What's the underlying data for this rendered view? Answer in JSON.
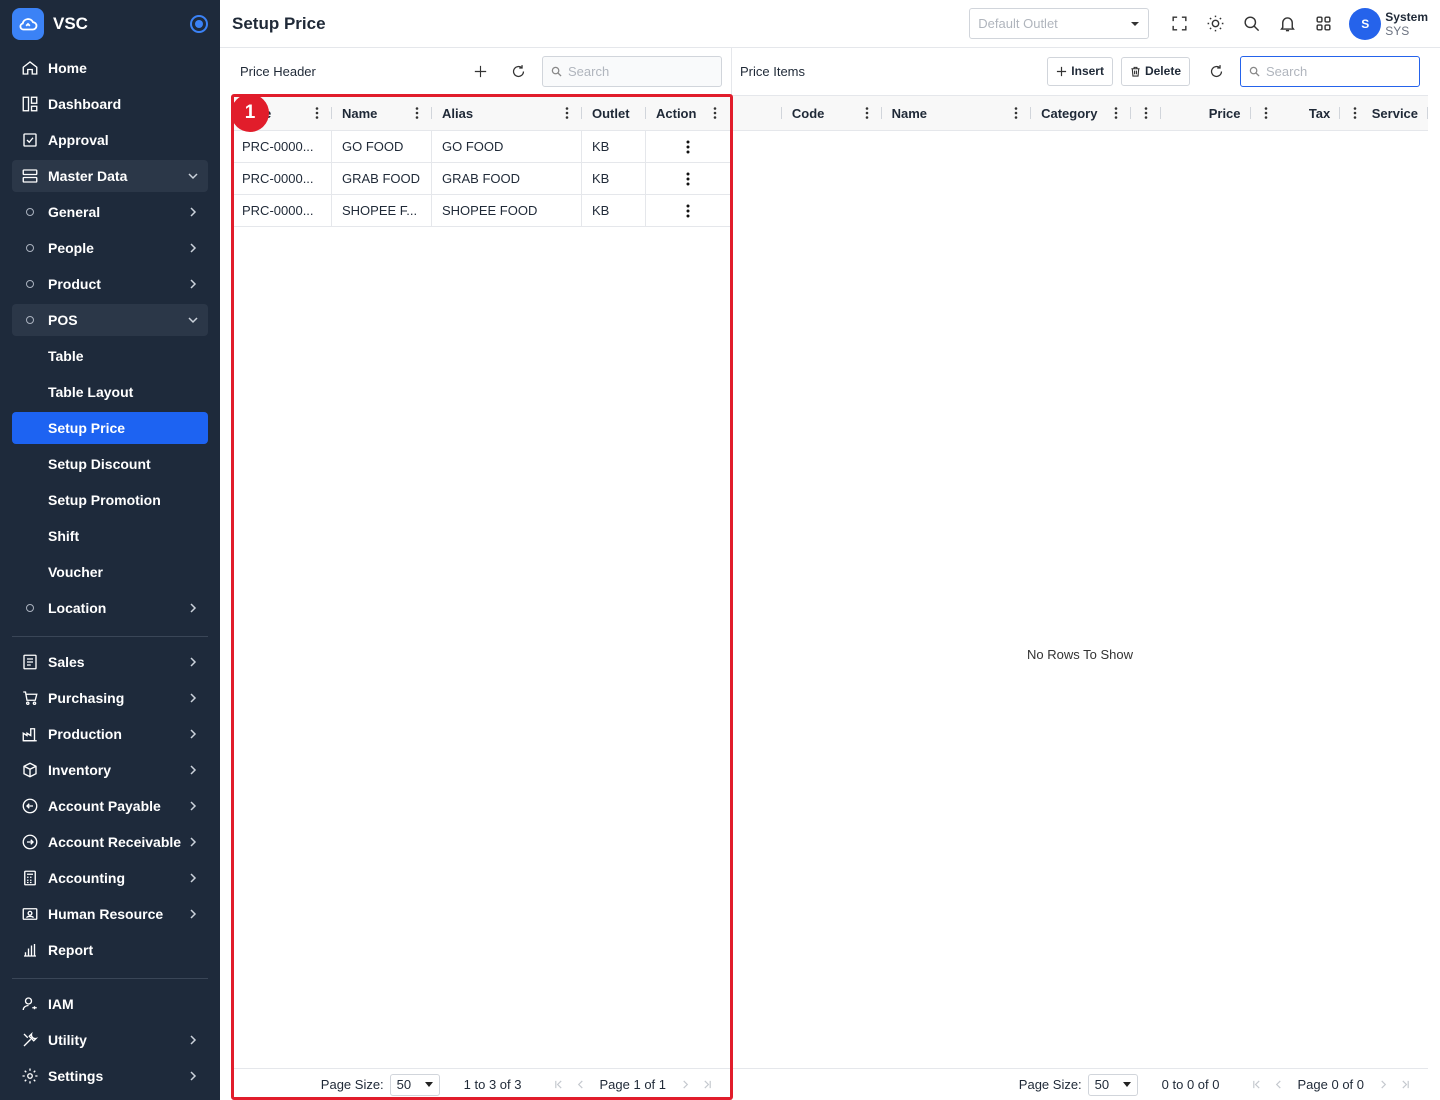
{
  "app": {
    "name": "VSC"
  },
  "sidebar": {
    "items": [
      {
        "label": "Home",
        "icon": "home-icon"
      },
      {
        "label": "Dashboard",
        "icon": "dashboard-icon"
      },
      {
        "label": "Approval",
        "icon": "approval-icon"
      },
      {
        "label": "Master Data",
        "icon": "master-data-icon"
      },
      {
        "label": "General"
      },
      {
        "label": "People"
      },
      {
        "label": "Product"
      },
      {
        "label": "POS"
      },
      {
        "label": "Table"
      },
      {
        "label": "Table Layout"
      },
      {
        "label": "Setup Price"
      },
      {
        "label": "Setup Discount"
      },
      {
        "label": "Setup Promotion"
      },
      {
        "label": "Shift"
      },
      {
        "label": "Voucher"
      },
      {
        "label": "Location"
      },
      {
        "label": "Sales",
        "icon": "sales-icon"
      },
      {
        "label": "Purchasing",
        "icon": "cart-icon"
      },
      {
        "label": "Production",
        "icon": "factory-icon"
      },
      {
        "label": "Inventory",
        "icon": "box-icon"
      },
      {
        "label": "Account Payable",
        "icon": "arrow-left-circle-icon"
      },
      {
        "label": "Account Receivable",
        "icon": "arrow-right-circle-icon"
      },
      {
        "label": "Accounting",
        "icon": "calculator-icon"
      },
      {
        "label": "Human Resource",
        "icon": "id-card-icon"
      },
      {
        "label": "Report",
        "icon": "bar-chart-icon"
      },
      {
        "label": "IAM",
        "icon": "user-key-icon"
      },
      {
        "label": "Utility",
        "icon": "tools-icon"
      },
      {
        "label": "Settings",
        "icon": "gear-icon"
      }
    ]
  },
  "header": {
    "title": "Setup Price",
    "outlet_placeholder": "Default Outlet",
    "user": {
      "initial": "S",
      "name": "System",
      "code": "SYS"
    }
  },
  "price_header": {
    "title": "Price Header",
    "search_placeholder": "Search",
    "columns": [
      "e",
      "Name",
      "Alias",
      "Outlet",
      "Action"
    ],
    "rows": [
      {
        "code": "PRC-0000...",
        "name": "GO FOOD",
        "alias": "GO FOOD",
        "outlet": "KB"
      },
      {
        "code": "PRC-0000...",
        "name": "GRAB FOOD",
        "alias": "GRAB FOOD",
        "outlet": "KB"
      },
      {
        "code": "PRC-0000...",
        "name": "SHOPEE F...",
        "alias": "SHOPEE FOOD",
        "outlet": "KB"
      }
    ],
    "footer": {
      "page_size_label": "Page Size:",
      "page_size": "50",
      "range": "1 to 3 of 3",
      "page": "Page 1 of 1"
    }
  },
  "price_items": {
    "title": "Price Items",
    "insert_label": "Insert",
    "delete_label": "Delete",
    "search_placeholder": "Search",
    "columns": [
      "Code",
      "Name",
      "Category",
      "",
      "Price",
      "Tax",
      "Service"
    ],
    "empty_text": "No Rows To Show",
    "footer": {
      "page_size_label": "Page Size:",
      "page_size": "50",
      "range": "0 to 0 of 0",
      "page": "Page 0 of 0"
    }
  },
  "annotation": {
    "badge": "1",
    "color": "#e11d2b"
  },
  "colors": {
    "sidebar_bg": "#1e2a3b",
    "active": "#1d63f2",
    "accent": "#2563eb"
  }
}
